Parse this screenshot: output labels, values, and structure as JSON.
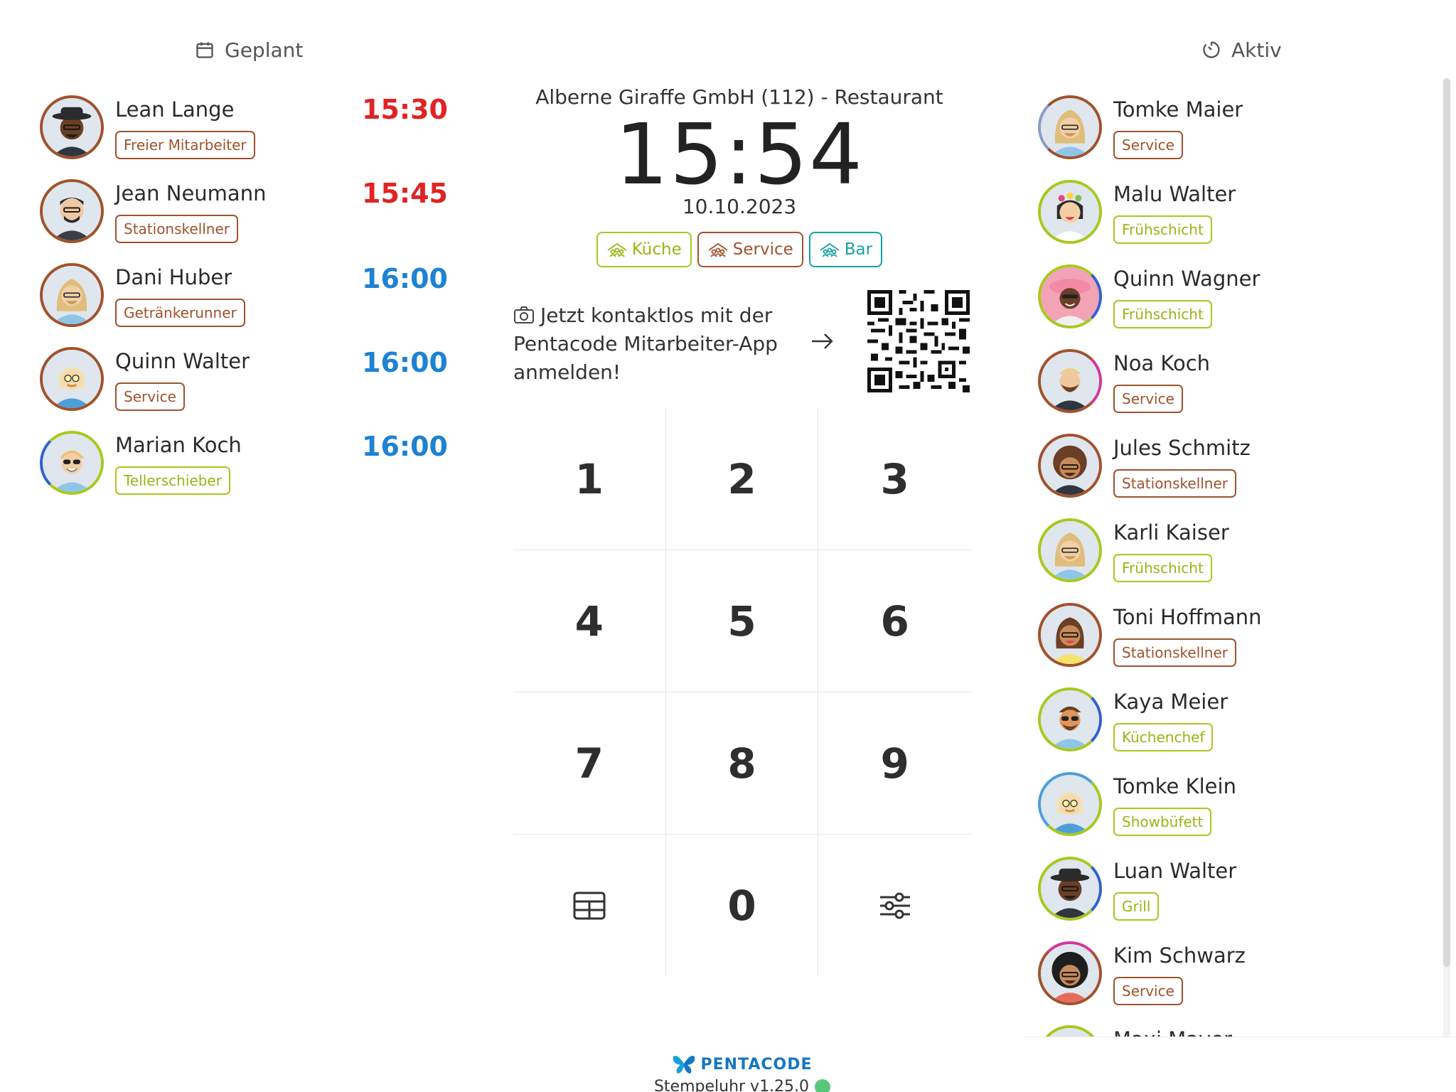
{
  "headers": {
    "planned": "Geplant",
    "active": "Aktiv"
  },
  "company": "Alberne Giraffe GmbH (112) - Restaurant",
  "clock": {
    "time": "15:54",
    "date": "10.10.2023"
  },
  "departments": [
    "Küche",
    "Service",
    "Bar"
  ],
  "app_login": {
    "text": "Jetzt kontaktlos mit der Pentacode Mitarbeiter-App anmelden!"
  },
  "planned": [
    {
      "name": "Lean Lange",
      "tag": "Freier Mitarbeiter",
      "time": "15:30"
    },
    {
      "name": "Jean Neumann",
      "tag": "Stationskellner",
      "time": "15:45"
    },
    {
      "name": "Dani Huber",
      "tag": "Getränkerunner",
      "time": "16:00"
    },
    {
      "name": "Quinn Walter",
      "tag": "Service",
      "time": "16:00"
    },
    {
      "name": "Marian Koch",
      "tag": "Tellerschieber",
      "time": "16:00"
    }
  ],
  "active": [
    {
      "name": "Tomke Maier",
      "tag": "Service"
    },
    {
      "name": "Malu Walter",
      "tag": "Frühschicht"
    },
    {
      "name": "Quinn Wagner",
      "tag": "Frühschicht"
    },
    {
      "name": "Noa Koch",
      "tag": "Service"
    },
    {
      "name": "Jules Schmitz",
      "tag": "Stationskellner"
    },
    {
      "name": "Karli Kaiser",
      "tag": "Frühschicht"
    },
    {
      "name": "Toni Hoffmann",
      "tag": "Stationskellner"
    },
    {
      "name": "Kaya Meier",
      "tag": "Küchenchef"
    },
    {
      "name": "Tomke Klein",
      "tag": "Showbüfett"
    },
    {
      "name": "Luan Walter",
      "tag": "Grill"
    },
    {
      "name": "Kim Schwarz",
      "tag": "Service"
    },
    {
      "name": "Maxi Mayer",
      "tag": ""
    }
  ],
  "keypad": [
    "1",
    "2",
    "3",
    "4",
    "5",
    "6",
    "7",
    "8",
    "9",
    "0"
  ],
  "footer": {
    "brand": "PENTACODE",
    "version": "Stempeluhr v1.25.0"
  },
  "colors": {
    "brown": "#a0522d",
    "lime": "#a8c81e",
    "teal": "#17a2a2",
    "red": "#e02424",
    "blue": "#1e82d2",
    "online": "#59c77a"
  }
}
